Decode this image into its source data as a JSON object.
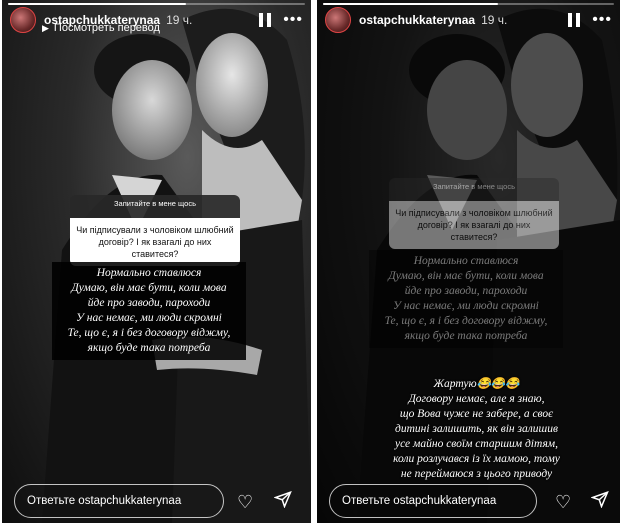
{
  "left_story": {
    "username": "ostapchukkaterynaa",
    "time": "19 ч.",
    "translate_label": "Посмотреть перевод",
    "question": {
      "header": "Запитайте в мене щось",
      "text_lines": [
        "Чи підписували з чоловіком шлюбний",
        "договір? І як взагалі до них ставитеся?"
      ]
    },
    "answer_lines": [
      "Нормально ставлюся",
      "Думаю, він має бути, коли мова",
      "йде про заводи, пароходи",
      "У нас немає, ми люди скромні",
      "Те, що є, я і без договору віджму,",
      "якщо буде така потреба"
    ],
    "reply_placeholder": "Ответьте ostapchukkaterynaa",
    "progress": 0.6
  },
  "right_story": {
    "username": "ostapchukkaterynaa",
    "time": "19 ч.",
    "question": {
      "header": "Запитайте в мене щось",
      "text_lines": [
        "Чи підписували з чоловіком шлюбний",
        "договір? І як взагалі до них ставитеся?"
      ]
    },
    "answer_lines": [
      "Нормально ставлюся",
      "Думаю, він має бути, коли мова",
      "йде про заводи, пароходи",
      "У нас немає, ми люди скромні",
      "Те, що є, я і без договору віджму,",
      "якщо буде така потреба"
    ],
    "extra_lines": [
      "Жартую😂😂😂",
      "Договору немає, але я знаю,",
      "що Вова чуже не забере, а своє",
      "дитині залишить, як він залишив",
      "усе майно своїм старшим дітям,",
      "коли розлучався із їх мамою, тому",
      "не переймаюся з цього приводу"
    ],
    "reply_placeholder": "Ответьте ostapchukkaterynaa",
    "progress": 0.6
  },
  "icons": {
    "pause": "pause-icon",
    "more": "more-icon",
    "like": "heart-icon",
    "share": "send-icon",
    "translate": "translate-icon"
  }
}
